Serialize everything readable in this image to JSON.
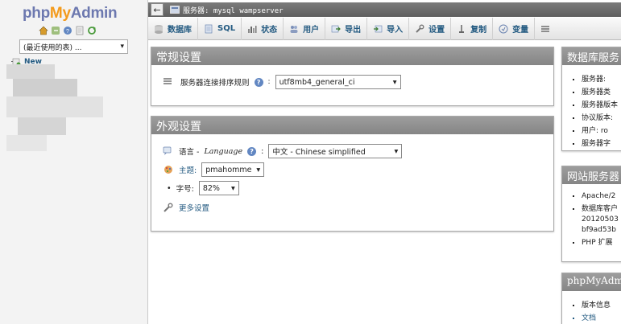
{
  "logo": {
    "php": "php",
    "my": "My",
    "admin": "Admin"
  },
  "left": {
    "recent_select": "(最近使用的表) ...",
    "tree_new": "New"
  },
  "server_bar": {
    "label": "服务器: mysql wampserver"
  },
  "tabs": [
    {
      "label": "数据库",
      "icon": "database-icon"
    },
    {
      "label": "SQL",
      "icon": "sql-icon"
    },
    {
      "label": "状态",
      "icon": "status-icon"
    },
    {
      "label": "用户",
      "icon": "users-icon"
    },
    {
      "label": "导出",
      "icon": "export-icon"
    },
    {
      "label": "导入",
      "icon": "import-icon"
    },
    {
      "label": "设置",
      "icon": "settings-wrench-icon"
    },
    {
      "label": "复制",
      "icon": "replication-icon"
    },
    {
      "label": "变量",
      "icon": "variables-icon"
    }
  ],
  "general": {
    "title": "常规设置",
    "collation_label": "服务器连接排序规则",
    "collation_value": "utf8mb4_general_ci"
  },
  "appearance": {
    "title": "外观设置",
    "language_label": "语言 - ",
    "language_italic": "Language",
    "language_value": "中文 - Chinese simplified",
    "theme_label": "主题:",
    "theme_value": "pmahomme",
    "fontsize_label": "字号:",
    "fontsize_value": "82%",
    "more_settings": "更多设置"
  },
  "db_server": {
    "title": "数据库服务",
    "items": [
      "服务器:",
      "服务器类",
      "服务器版本",
      "协议版本:",
      "用户: ro",
      "服务器字"
    ]
  },
  "web_server": {
    "title": "网站服务器",
    "items": [
      "Apache/2",
      "数据库客户",
      "20120503",
      "bf9ad53b",
      "PHP 扩展"
    ]
  },
  "pma": {
    "title": "phpMyAdmin",
    "items": [
      "版本信息",
      "文档"
    ]
  },
  "colors": {
    "accent_link": "#235a81",
    "panel_header": "#8f8f8f",
    "logo_orange": "#f39a1b",
    "logo_blue": "#6c78af"
  }
}
